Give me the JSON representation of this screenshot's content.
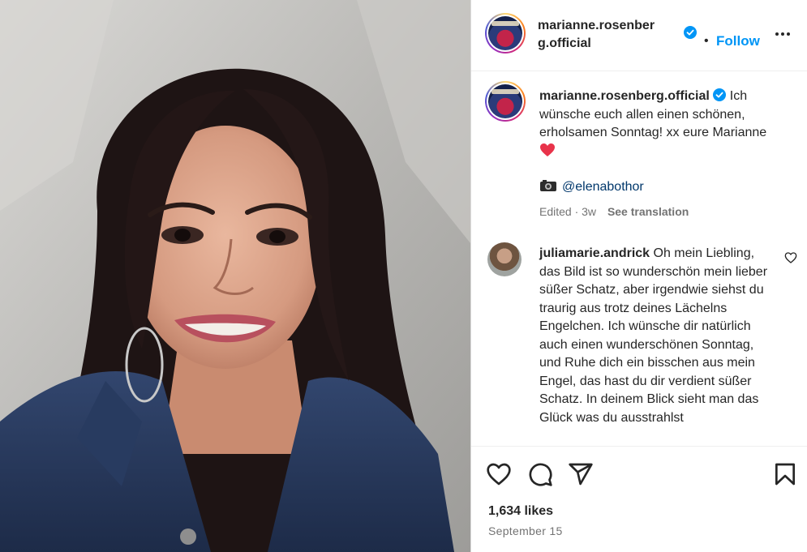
{
  "post": {
    "image_alt": "Portrait photo",
    "author": "marianne.rosenberg.official",
    "verified": true,
    "dot": "•",
    "follow_label": "Follow",
    "more_icon": "more-horizontal-icon"
  },
  "caption": {
    "username": "marianne.rosenberg.official",
    "text": "Ich wünsche euch allen einen schönen, erholsamen Sonntag! xx eure Marianne",
    "emoji": "red-heart",
    "credit_handle": "@elenabothor",
    "edited": "Edited · 3w",
    "see_translation": "See translation"
  },
  "comments": [
    {
      "username": "juliamarie.andrick",
      "text": "Oh mein Liebling, das Bild ist so wunderschön mein lieber süßer Schatz, aber irgendwie siehst du traurig aus trotz deines Lächelns Engelchen. Ich wünsche dir natürlich auch einen wunderschönen Sonntag, und Ruhe dich ein bisschen aus mein Engel, das hast du dir verdient süßer Schatz. In deinem Blick sieht man das Glück was du ausstrahlst"
    }
  ],
  "actions": {
    "likes": "1,634 likes",
    "date": "September 15"
  },
  "colors": {
    "accent": "#0095f6",
    "verified": "#0095f6",
    "heart": "#e8334a"
  }
}
